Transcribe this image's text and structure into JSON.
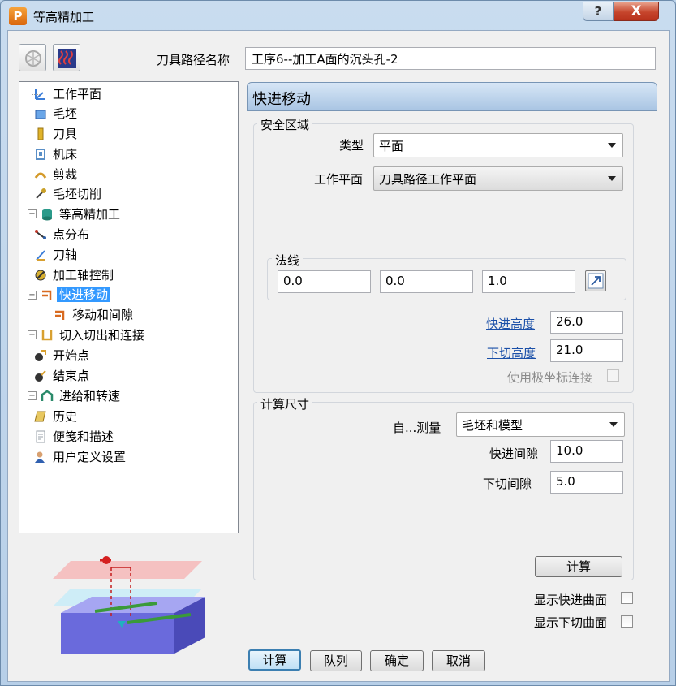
{
  "window": {
    "title": "等高精加工",
    "app_icon_letter": "P",
    "help_label": "?",
    "close_label": "X"
  },
  "header": {
    "name_label": "刀具路径名称",
    "name_value": "工序6--加工A面的沉头孔-2"
  },
  "tree": {
    "items": [
      {
        "label": "工作平面",
        "icon": "workplane-icon",
        "color": "#3b7dd8"
      },
      {
        "label": "毛坯",
        "icon": "block-icon",
        "color": "#6aa6e8"
      },
      {
        "label": "刀具",
        "icon": "tool-icon",
        "color": "#e0b32a"
      },
      {
        "label": "机床",
        "icon": "machine-icon",
        "color": "#5a8fc7"
      },
      {
        "label": "剪裁",
        "icon": "trim-icon",
        "color": "#d49a2a"
      },
      {
        "label": "毛坯切削",
        "icon": "stock-cut-icon",
        "color": "#c9a028"
      },
      {
        "label": "等高精加工",
        "icon": "database-icon",
        "color": "#2a9a8a"
      },
      {
        "label": "点分布",
        "icon": "point-distribution-icon",
        "color": "#c0392b"
      },
      {
        "label": "刀轴",
        "icon": "tool-axis-icon",
        "color": "#d8a030"
      },
      {
        "label": "加工轴控制",
        "icon": "axis-control-icon",
        "color": "#d8b030"
      },
      {
        "label": "快进移动",
        "icon": "rapid-move-icon",
        "color": "#d86a20"
      },
      {
        "label": "移动和间隙",
        "icon": "moves-gaps-icon",
        "color": "#d86a20"
      },
      {
        "label": "切入切出和连接",
        "icon": "leads-links-icon",
        "color": "#d8a030"
      },
      {
        "label": "开始点",
        "icon": "start-point-icon",
        "color": "#333333"
      },
      {
        "label": "结束点",
        "icon": "end-point-icon",
        "color": "#333333"
      },
      {
        "label": "进给和转速",
        "icon": "feeds-speeds-icon",
        "color": "#2a8a6a"
      },
      {
        "label": "历史",
        "icon": "history-icon",
        "color": "#c9a028"
      },
      {
        "label": "便笺和描述",
        "icon": "notes-icon",
        "color": "#9aa0a8"
      },
      {
        "label": "用户定义设置",
        "icon": "user-settings-icon",
        "color": "#3060b0"
      }
    ]
  },
  "panel": {
    "title": "快进移动",
    "safe_area": {
      "group_label": "安全区域",
      "type_label": "类型",
      "type_value": "平面",
      "workplane_label": "工作平面",
      "workplane_value": "刀具路径工作平面",
      "normal_label": "法线",
      "normal_x": "0.0",
      "normal_y": "0.0",
      "normal_z": "1.0",
      "rapid_height_label": "快进高度",
      "rapid_height_value": "26.0",
      "plunge_height_label": "下切高度",
      "plunge_height_value": "21.0",
      "polar_label": "使用极坐标连接"
    },
    "calc_dims": {
      "group_label": "计算尺寸",
      "measure_label": "自...测量",
      "measure_value": "毛坯和模型",
      "rapid_gap_label": "快进间隙",
      "rapid_gap_value": "10.0",
      "plunge_gap_label": "下切间隙",
      "plunge_gap_value": "5.0",
      "calc_button": "计算"
    },
    "show_rapid_label": "显示快进曲面",
    "show_plunge_label": "显示下切曲面"
  },
  "footer": {
    "calculate": "计算",
    "queue": "队列",
    "ok": "确定",
    "cancel": "取消"
  }
}
